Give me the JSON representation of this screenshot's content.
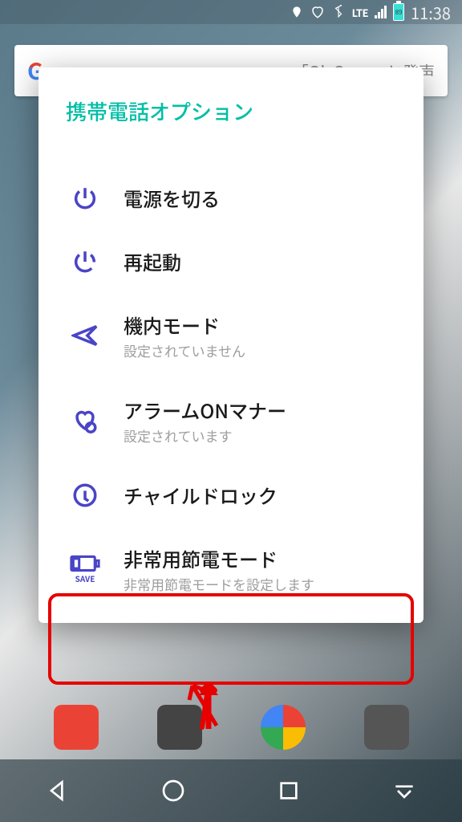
{
  "status": {
    "lte": "LTE",
    "battery": "89",
    "time": "11:38"
  },
  "search": {
    "placeholder": "「Ok Go…」と発声",
    "logo": "G"
  },
  "dialog": {
    "title": "携帯電話オプション",
    "options": [
      {
        "label": "電源を切る",
        "sub": ""
      },
      {
        "label": "再起動",
        "sub": ""
      },
      {
        "label": "機内モード",
        "sub": "設定されていません"
      },
      {
        "label": "アラームONマナー",
        "sub": "設定されています"
      },
      {
        "label": "チャイルドロック",
        "sub": ""
      },
      {
        "label": "非常用節電モード",
        "sub": "非常用節電モードを設定します"
      }
    ],
    "save_icon_text": "SAVE"
  }
}
